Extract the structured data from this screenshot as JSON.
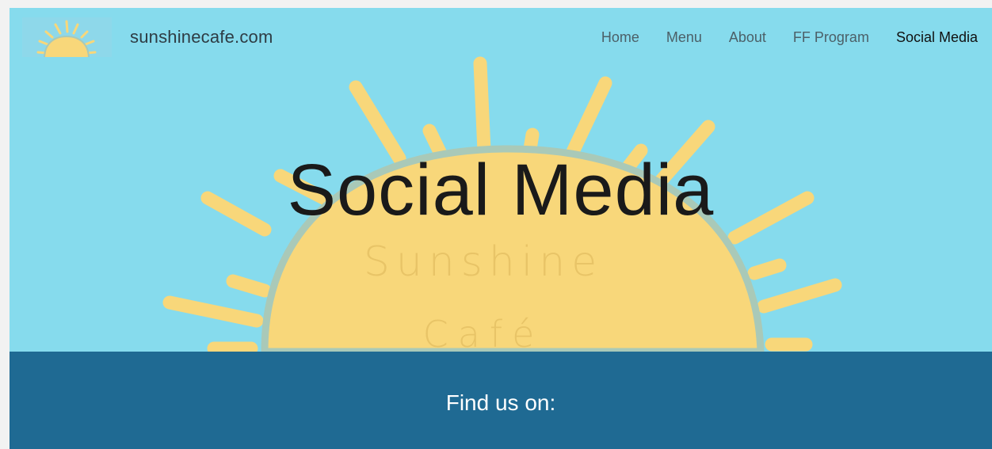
{
  "site": {
    "name": "sunshinecafe.com"
  },
  "nav": {
    "items": [
      {
        "label": "Home"
      },
      {
        "label": "Menu"
      },
      {
        "label": "About"
      },
      {
        "label": "FF Program"
      },
      {
        "label": "Social Media"
      }
    ],
    "active": "Social Media"
  },
  "hero": {
    "title": "Social Media",
    "art_text_line1": "Sunshine",
    "art_text_line2": "Café"
  },
  "banner": {
    "text": "Find us on:"
  },
  "colors": {
    "sky": "#86dbed",
    "sun": "#f8d77a",
    "sun_edge": "#a9c9b8",
    "banner": "#1f6a93",
    "banner_text": "#ffffff"
  }
}
